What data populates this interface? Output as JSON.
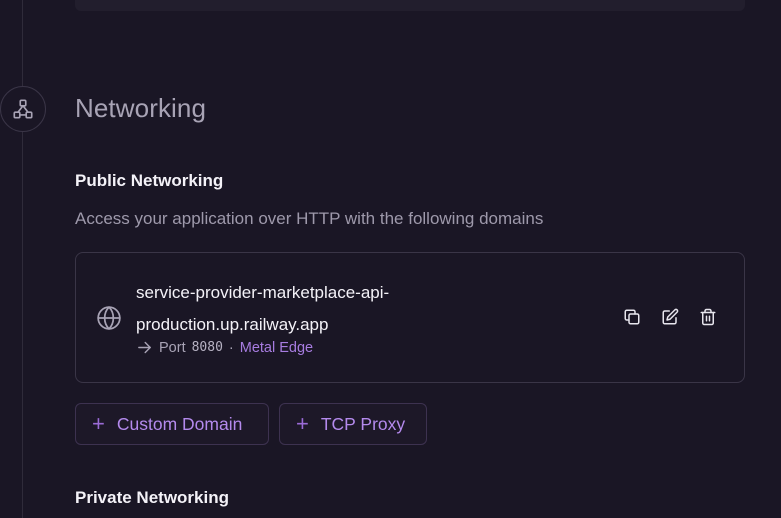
{
  "networking": {
    "title": "Networking",
    "public": {
      "title": "Public Networking",
      "description": "Access your application over HTTP with the following domains",
      "domain": {
        "line1": "service-provider-marketplace-api-",
        "line2": "production.up.railway.app",
        "port_label": "Port",
        "port_value": "8080",
        "separator": "·",
        "edge_label": "Metal Edge"
      },
      "actions": [
        "copy-icon",
        "edit-icon",
        "trash-icon"
      ]
    },
    "buttons": {
      "custom_domain": "Custom Domain",
      "tcp_proxy": "TCP Proxy"
    },
    "private": {
      "title": "Private Networking"
    }
  },
  "colors": {
    "background": "#1a1625",
    "accent": "#b48aed",
    "edge_link": "#a77ce0",
    "border": "#3a3547"
  }
}
